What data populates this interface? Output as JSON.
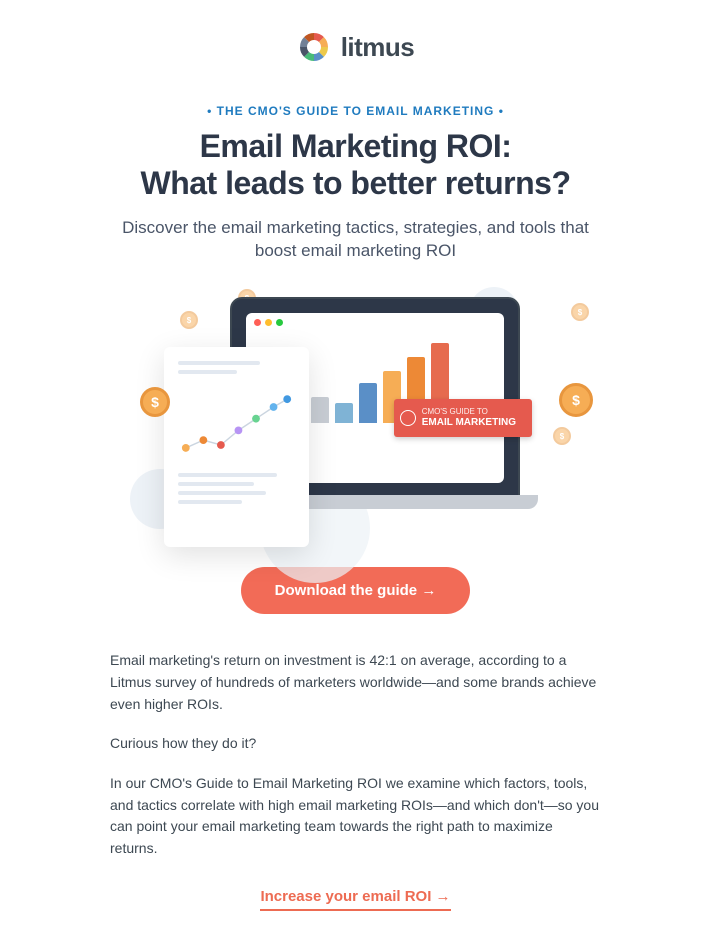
{
  "brand": {
    "name": "litmus"
  },
  "hero": {
    "eyebrow": "• THE CMO'S GUIDE TO EMAIL MARKETING •",
    "headline_l1": "Email Marketing ROI:",
    "headline_l2": "What leads to better returns?",
    "subhead": "Discover the email marketing tactics, strategies, and tools that boost email marketing ROI"
  },
  "illustration": {
    "banner_l1": "CMO'S GUIDE TO",
    "banner_l2": "EMAIL MARKETING",
    "coin_glyph": "$"
  },
  "cta": {
    "download_label": "Download the guide →"
  },
  "body": {
    "p1": "Email marketing's return on investment is 42:1 on average, according to a Litmus survey of hundreds of marketers worldwide—and some brands achieve even higher ROIs.",
    "p2": "Curious how they do it?",
    "p3": "In our CMO's Guide to Email Marketing ROI we examine which factors, tools, and tactics correlate with high email marketing ROIs—and which don't—so you can point your email marketing team towards the right path to maximize returns."
  },
  "footer_link": {
    "label": "Increase your email ROI →"
  },
  "colors": {
    "accent": "#f26b57",
    "eyebrow": "#1f7bbf"
  }
}
